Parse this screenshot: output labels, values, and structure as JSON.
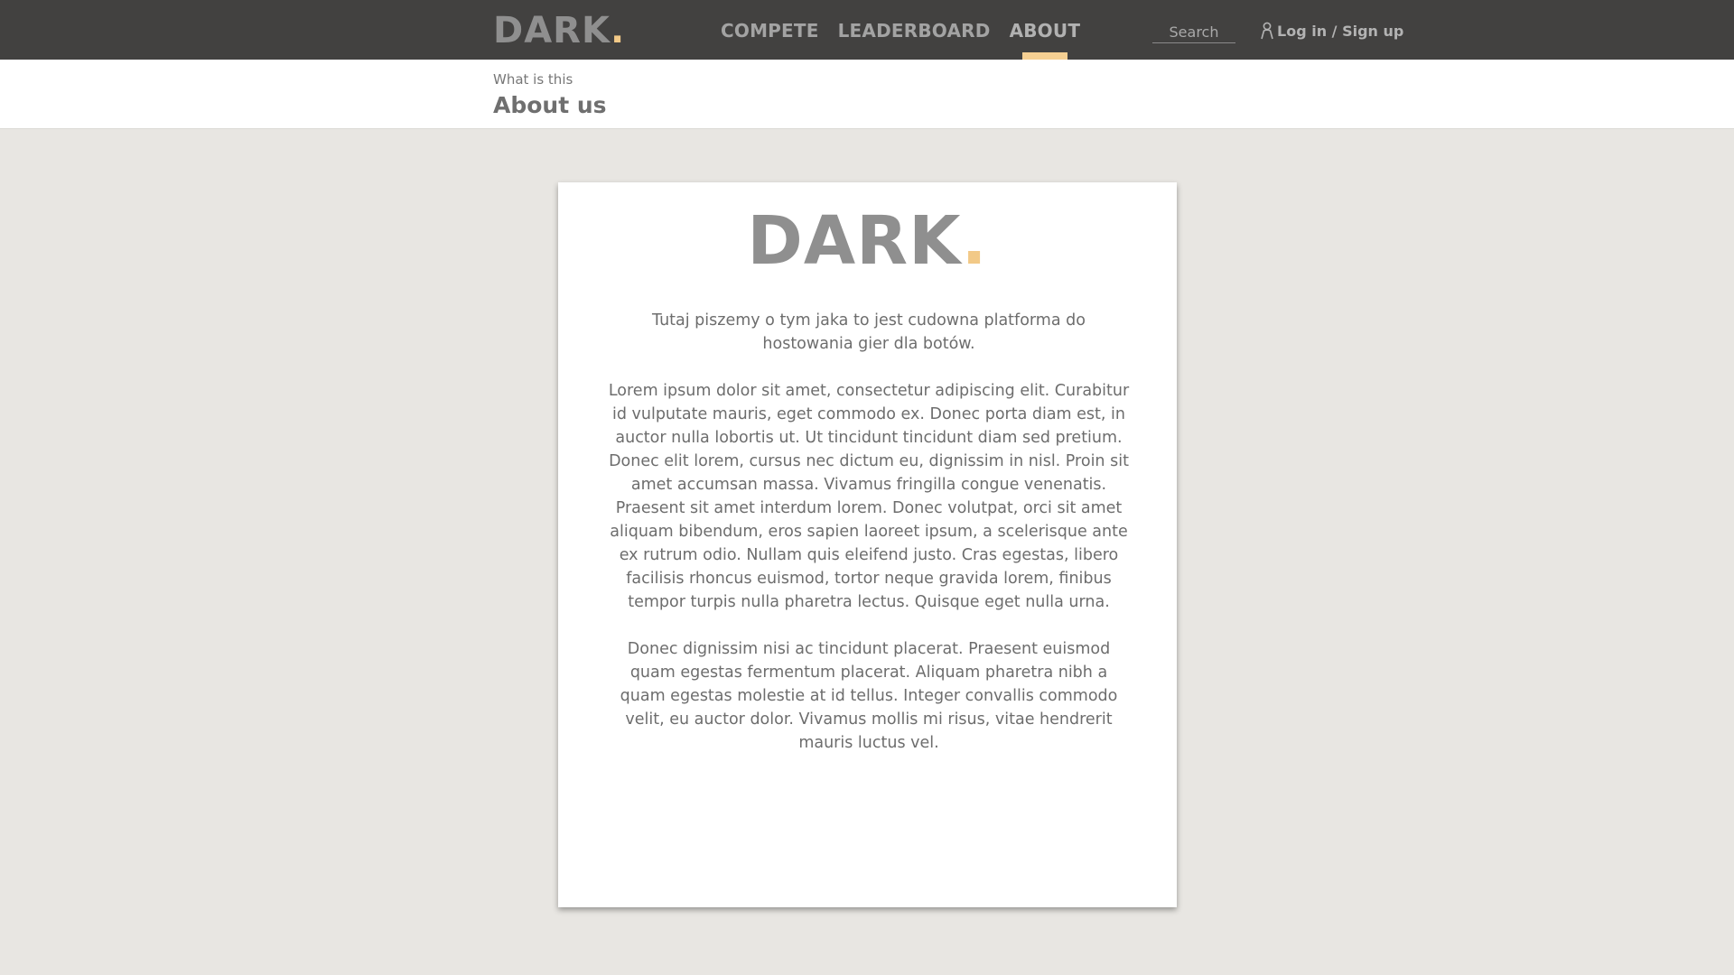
{
  "header": {
    "brand": {
      "text": "DARK",
      "dot": "."
    },
    "nav": [
      {
        "label": "COMPETE",
        "active": false
      },
      {
        "label": "LEADERBOARD",
        "active": false
      },
      {
        "label": "ABOUT",
        "active": true
      }
    ],
    "search": {
      "placeholder": "Search",
      "value": ""
    },
    "login": {
      "label": "Log in / Sign up",
      "icon": "user-icon"
    }
  },
  "subheader": {
    "eyebrow": "What is this",
    "title": "About us"
  },
  "card": {
    "logo": {
      "text": "DARK",
      "dot": "."
    },
    "paragraphs": [
      "Tutaj piszemy o tym jaka to jest cudowna platforma do hostowania gier dla botów.",
      "Lorem ipsum dolor sit amet, consectetur adipiscing elit. Curabitur id vulputate mauris, eget commodo ex. Donec porta diam est, in auctor nulla lobortis ut. Ut tincidunt tincidunt diam sed pretium. Donec elit lorem, cursus nec dictum eu, dignissim in nisl. Proin sit amet accumsan massa. Vivamus fringilla congue venenatis. Praesent sit amet interdum lorem. Donec volutpat, orci sit amet aliquam bibendum, eros sapien laoreet ipsum, a scelerisque ante ex rutrum odio. Nullam quis eleifend justo. Cras egestas, libero facilisis rhoncus euismod, tortor neque gravida lorem, finibus tempor turpis nulla pharetra lectus. Quisque eget nulla urna.",
      "Donec dignissim nisi ac tincidunt placerat. Praesent euismod quam egestas fermentum placerat. Aliquam pharetra nibh a quam egestas molestie at id tellus. Integer convallis commodo velit, eu auctor dolor. Vivamus mollis mi risus, vitae hendrerit mauris luctus vel."
    ]
  },
  "colors": {
    "topbar": "#424140",
    "accent": "#f2c987",
    "page_background": "#e8e6e2",
    "card_background": "#ffffff"
  }
}
